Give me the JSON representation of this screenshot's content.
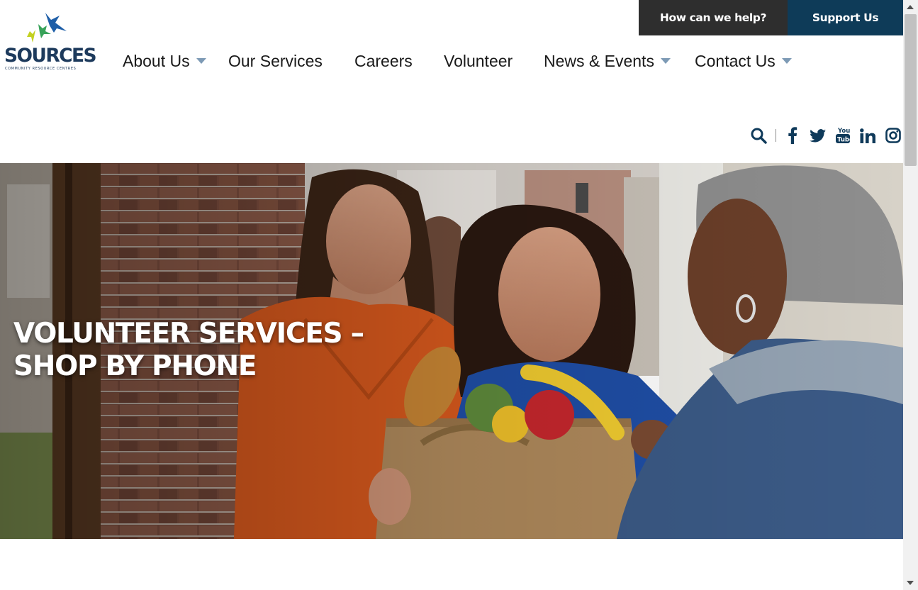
{
  "utility": {
    "help_label": "How can we help?",
    "support_label": "Support Us"
  },
  "logo": {
    "wordmark": "SOURCES",
    "tagline": "COMMUNITY RESOURCE CENTRES"
  },
  "nav": {
    "items": [
      {
        "label": "About Us",
        "has_dropdown": true
      },
      {
        "label": "Our Services",
        "has_dropdown": false
      },
      {
        "label": "Careers",
        "has_dropdown": false
      },
      {
        "label": "Volunteer",
        "has_dropdown": false
      },
      {
        "label": "News & Events",
        "has_dropdown": true
      },
      {
        "label": "Contact Us",
        "has_dropdown": true
      }
    ]
  },
  "social": {
    "icons": [
      "search-icon",
      "facebook-icon",
      "twitter-icon",
      "youtube-icon",
      "linkedin-icon",
      "instagram-icon"
    ]
  },
  "hero": {
    "title": "VOLUNTEER SERVICES – SHOP BY PHONE"
  },
  "colors": {
    "brand_navy": "#0e3b58",
    "utility_dark": "#2e2e2e",
    "caret": "#7d9ab5",
    "icon_navy": "#0f3a5a"
  }
}
